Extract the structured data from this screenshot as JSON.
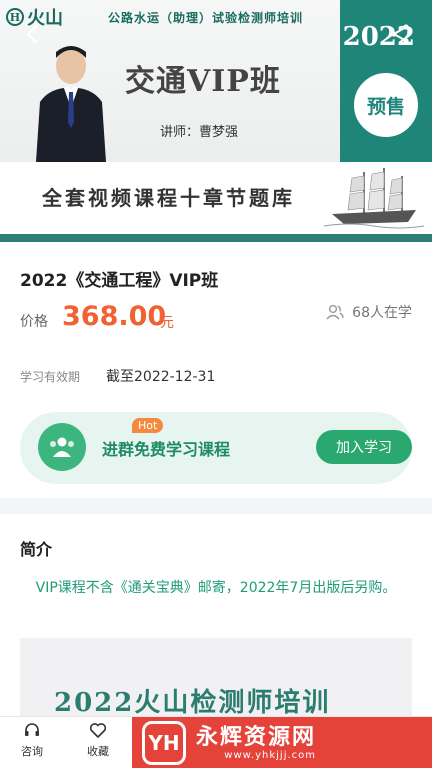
{
  "banner": {
    "logo_text": "火山",
    "logo_mark": "H",
    "subtitle": "公路水运（助理）试验检测师培训",
    "year": "2022",
    "title": "交通VIP班",
    "lecturer": "讲师：曹梦强",
    "presale": "预售",
    "strip_text": "全套视频课程十章节题库",
    "back_icon": "back-arrow-icon",
    "share_icon": "share-icon"
  },
  "course": {
    "title": "2022《交通工程》VIP班",
    "price_label": "价格",
    "price": "368.00",
    "price_unit": "元",
    "learners": "68人在学",
    "validity_label": "学习有效期",
    "validity_value": "截至2022-12-31"
  },
  "group": {
    "hot": "Hot",
    "text": "进群免费学习课程",
    "button": "加入学习"
  },
  "intro": {
    "heading": "简介",
    "note": "VIP课程不含《通关宝典》邮寄，2022年7月出版后另购。",
    "image_text": "2022火山检测师培训"
  },
  "bottom": {
    "consult": "咨询",
    "favorite": "收藏"
  },
  "watermark": {
    "title": "永辉资源网",
    "url": "www.yhkjjj.com",
    "mark": "YH"
  },
  "colors": {
    "brand_teal": "#1f8578",
    "price_orange": "#f06231",
    "join_green": "#2aa870"
  }
}
